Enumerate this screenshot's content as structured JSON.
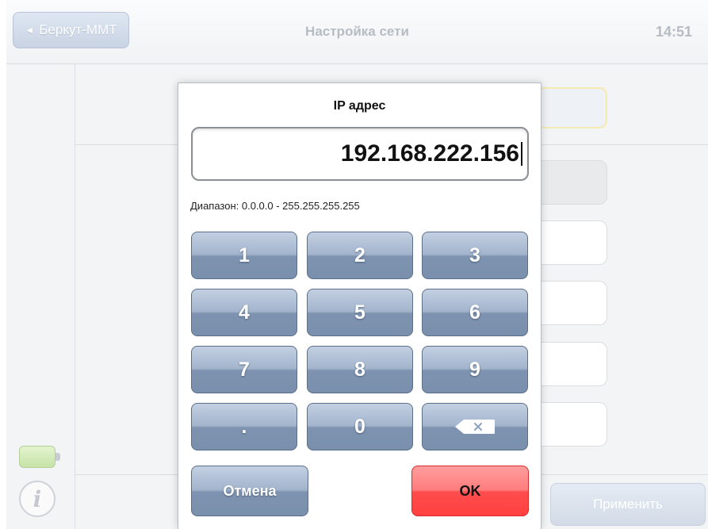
{
  "header": {
    "back_label": "Беркут-ММТ",
    "title": "Настройка сети",
    "time": "14:51"
  },
  "footer": {
    "apply_label": "Применить"
  },
  "dialog": {
    "title": "IP адрес",
    "value": "192.168.222.156",
    "range_text": "Диапазон: 0.0.0.0 - 255.255.255.255",
    "keys": [
      "1",
      "2",
      "3",
      "4",
      "5",
      "6",
      "7",
      "8",
      "9",
      ".",
      "0"
    ],
    "backspace_icon": "backspace-icon",
    "cancel_label": "Отмена",
    "ok_label": "OK"
  },
  "colors": {
    "key_blue": "#8fa3bf",
    "ok_red": "#ff5a5a",
    "battery_green": "#c6e3a7"
  }
}
